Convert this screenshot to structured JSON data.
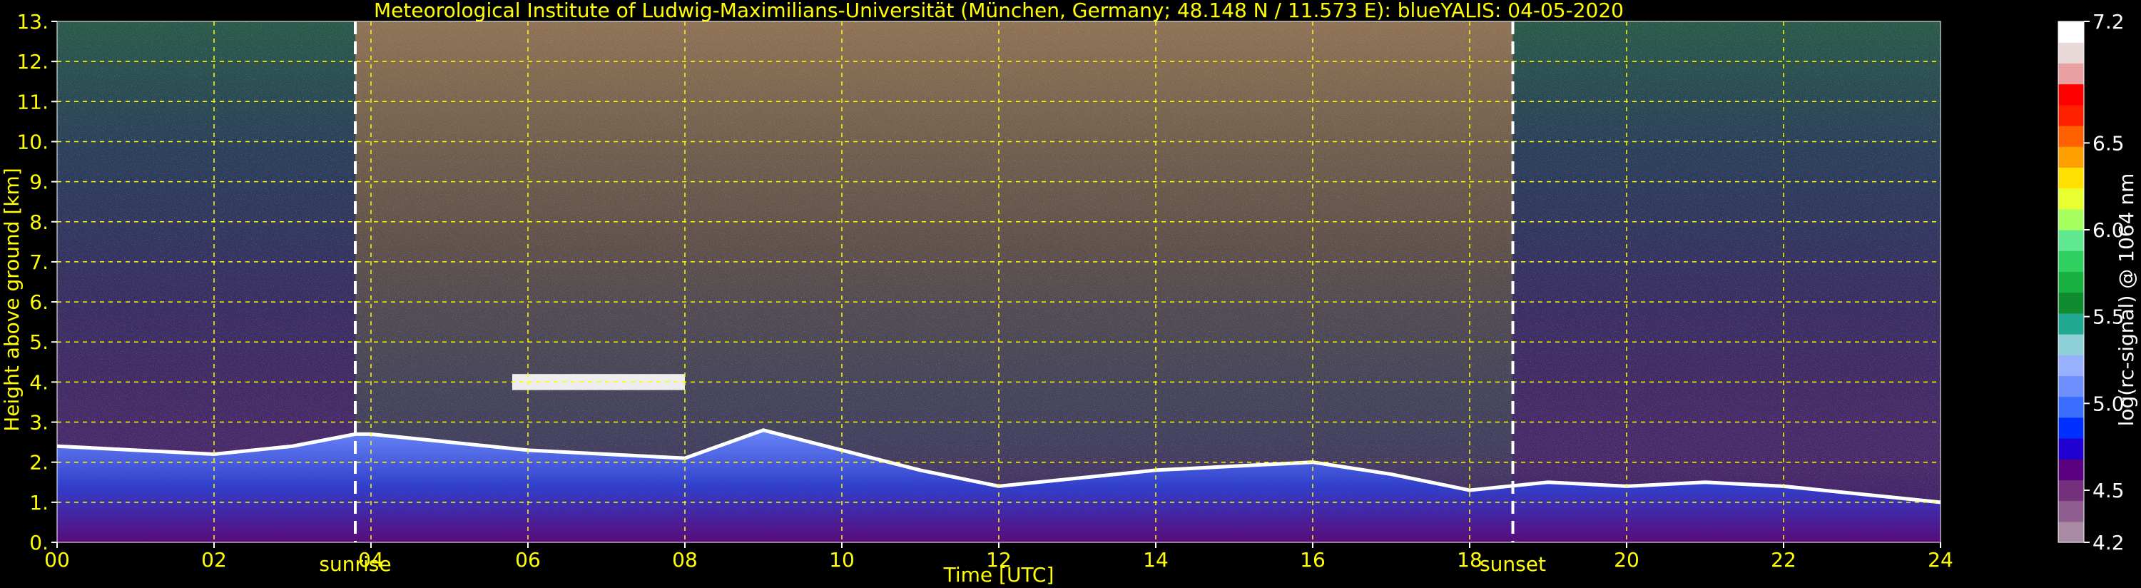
{
  "chart_data": {
    "type": "heatmap",
    "title": "Meteorological Institute of Ludwig-Maximilians-Universität (München, Germany; 48.148 N / 11.573 E):    blueYALIS: 04-05-2020",
    "xlabel": "Time [UTC]",
    "ylabel": "Height above ground [km]",
    "xlim": [
      0,
      24
    ],
    "ylim": [
      0,
      13
    ],
    "x_ticks": [
      "00",
      "02",
      "04",
      "06",
      "08",
      "10",
      "12",
      "14",
      "16",
      "18",
      "20",
      "22",
      "24"
    ],
    "x_tick_values": [
      0,
      2,
      4,
      6,
      8,
      10,
      12,
      14,
      16,
      18,
      20,
      22,
      24
    ],
    "y_ticks": [
      "0.",
      "1.",
      "2.",
      "3.",
      "4.",
      "5.",
      "6.",
      "7.",
      "8.",
      "9.",
      "10.",
      "11.",
      "12.",
      "13."
    ],
    "y_tick_values": [
      0,
      1,
      2,
      3,
      4,
      5,
      6,
      7,
      8,
      9,
      10,
      11,
      12,
      13
    ],
    "grid": true,
    "grid_color": "#ffff00",
    "annotations": [
      {
        "label": "sunrise",
        "x": 3.8
      },
      {
        "label": "sunset",
        "x": 18.55
      }
    ],
    "colorbar": {
      "label": "log(rc-signal) @ 1064 nm",
      "range": [
        4.2,
        7.2
      ],
      "ticks": [
        "7.2",
        "6.5",
        "6.0",
        "5.5",
        "5.0",
        "4.5",
        "4.2"
      ],
      "tick_values": [
        7.2,
        6.5,
        6.0,
        5.5,
        5.0,
        4.5,
        4.2
      ],
      "colors": [
        "#a88aa2",
        "#8e5f8e",
        "#74307a",
        "#5a0080",
        "#2000d0",
        "#0030ff",
        "#3a6cff",
        "#6e90ff",
        "#99b0ff",
        "#8fd0d8",
        "#20a890",
        "#108c30",
        "#18b040",
        "#30d060",
        "#60e890",
        "#a8ff60",
        "#e8ff30",
        "#ffe000",
        "#ffa000",
        "#ff6000",
        "#ff2000",
        "#ff0000",
        "#e8a0a0",
        "#e8d8d8",
        "#ffffff"
      ]
    },
    "features": [
      {
        "name": "boundary layer top",
        "x": [
          0,
          1,
          2,
          3,
          3.8,
          4,
          5,
          6,
          7,
          8,
          9,
          10,
          11,
          12,
          13,
          14,
          15,
          16,
          17,
          18,
          19,
          20,
          21,
          22,
          23,
          24
        ],
        "y": [
          2.4,
          2.3,
          2.2,
          2.4,
          2.7,
          2.7,
          2.5,
          2.3,
          2.2,
          2.1,
          2.8,
          2.3,
          1.8,
          1.4,
          1.6,
          1.8,
          1.9,
          2.0,
          1.7,
          1.3,
          1.5,
          1.4,
          1.5,
          1.4,
          1.2,
          1.0
        ]
      },
      {
        "name": "cloud layer",
        "x_range": [
          5.8,
          8.0
        ],
        "y": 4.0
      }
    ]
  }
}
